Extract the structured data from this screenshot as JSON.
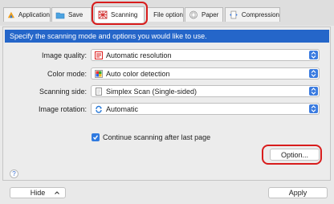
{
  "tabs": [
    {
      "label": "Application",
      "icon": "application-icon"
    },
    {
      "label": "Save",
      "icon": "folder-icon"
    },
    {
      "label": "Scanning",
      "icon": "scanning-icon",
      "active": true
    },
    {
      "label": "File option",
      "icon": "file-icon"
    },
    {
      "label": "Paper",
      "icon": "paper-icon"
    },
    {
      "label": "Compression",
      "icon": "compression-icon"
    }
  ],
  "banner": "Specify the scanning mode and options you would like to use.",
  "fields": {
    "image_quality": {
      "label": "Image quality:",
      "value": "Automatic resolution"
    },
    "color_mode": {
      "label": "Color mode:",
      "value": "Auto color detection"
    },
    "scanning_side": {
      "label": "Scanning side:",
      "value": "Simplex Scan (Single-sided)"
    },
    "image_rotation": {
      "label": "Image rotation:",
      "value": "Automatic"
    }
  },
  "checkbox": {
    "label": "Continue scanning after last page",
    "checked": true
  },
  "option_button": "Option...",
  "help": "?",
  "footer": {
    "hide": "Hide",
    "apply": "Apply"
  },
  "colors": {
    "accent": "#2566c9",
    "highlight": "#d81d1d"
  }
}
